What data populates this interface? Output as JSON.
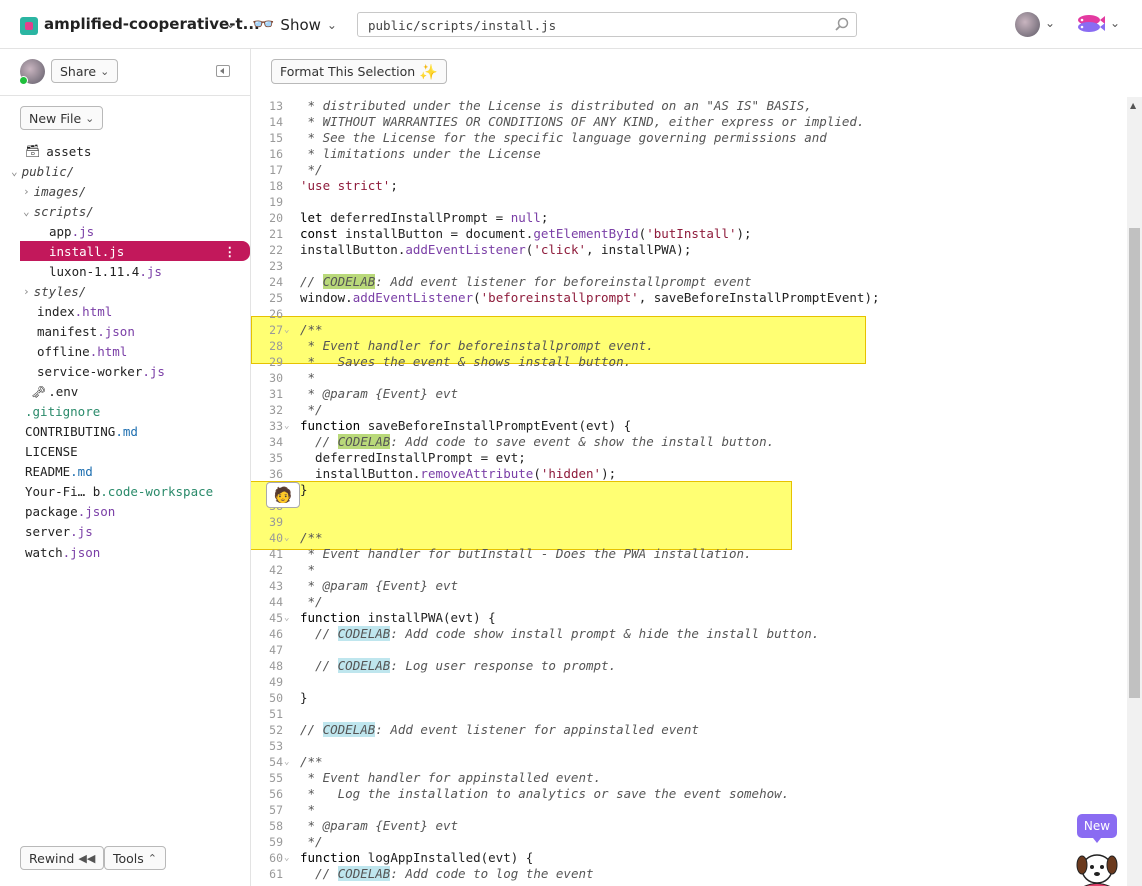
{
  "topbar": {
    "project_name": "amplified-cooperative-t...",
    "show_label": "Show",
    "path": "public/scripts/install.js"
  },
  "sidebar": {
    "share_label": "Share",
    "new_file_label": "New File",
    "rewind_label": "Rewind",
    "tools_label": "Tools",
    "tree": [
      {
        "label": "assets",
        "ext": "",
        "type": "assets",
        "depth": 0
      },
      {
        "label": "public/",
        "ext": "",
        "type": "dir-open",
        "depth": 0
      },
      {
        "label": "images/",
        "ext": "",
        "type": "dir-closed",
        "depth": 1
      },
      {
        "label": "scripts/",
        "ext": "",
        "type": "dir-open",
        "depth": 1
      },
      {
        "label": "app",
        "ext": ".js",
        "type": "file",
        "depth": 2
      },
      {
        "label": "install",
        "ext": ".js",
        "type": "file-selected",
        "depth": 2
      },
      {
        "label": "luxon-1.11.4",
        "ext": ".js",
        "type": "file",
        "depth": 2
      },
      {
        "label": "styles/",
        "ext": "",
        "type": "dir-closed",
        "depth": 1
      },
      {
        "label": "index",
        "ext": ".html",
        "type": "file",
        "depth": 1
      },
      {
        "label": "manifest",
        "ext": ".json",
        "type": "file",
        "depth": 1
      },
      {
        "label": "offline",
        "ext": ".html",
        "type": "file",
        "depth": 1
      },
      {
        "label": "service-worker",
        "ext": ".js",
        "type": "file",
        "depth": 1
      },
      {
        "label": ".env",
        "ext": "",
        "type": "env",
        "depth": 0
      },
      {
        "label": ".gitignore",
        "ext": "",
        "type": "file-green",
        "depth": 0
      },
      {
        "label": "CONTRIBUTING",
        "ext": ".md",
        "type": "file-md",
        "depth": 0
      },
      {
        "label": "LICENSE",
        "ext": "",
        "type": "file",
        "depth": 0
      },
      {
        "label": "README",
        "ext": ".md",
        "type": "file-md",
        "depth": 0
      },
      {
        "label": "Your-Fi… b",
        "ext": ".code-workspace",
        "type": "file-green",
        "depth": 0
      },
      {
        "label": "package",
        "ext": ".json",
        "type": "file",
        "depth": 0
      },
      {
        "label": "server",
        "ext": ".js",
        "type": "file",
        "depth": 0
      },
      {
        "label": "watch",
        "ext": ".json",
        "type": "file",
        "depth": 0
      }
    ]
  },
  "editor": {
    "format_label": "Format This Selection",
    "new_badge": "New",
    "lines": [
      {
        "n": "13",
        "fold": "",
        "segs": [
          [
            "cm",
            " * distributed under the License is distributed on an \"AS IS\" BASIS,"
          ]
        ]
      },
      {
        "n": "14",
        "fold": "",
        "segs": [
          [
            "cm",
            " * WITHOUT WARRANTIES OR CONDITIONS OF ANY KIND, either express or implied."
          ]
        ]
      },
      {
        "n": "15",
        "fold": "",
        "segs": [
          [
            "cm",
            " * See the License for the specific language governing permissions and"
          ]
        ]
      },
      {
        "n": "16",
        "fold": "",
        "segs": [
          [
            "cm",
            " * limitations under the License"
          ]
        ]
      },
      {
        "n": "17",
        "fold": "",
        "segs": [
          [
            "cm",
            " */"
          ]
        ]
      },
      {
        "n": "18",
        "fold": "",
        "segs": [
          [
            "str",
            "'use strict'"
          ],
          [
            "",
            ";"
          ]
        ]
      },
      {
        "n": "19",
        "fold": "",
        "segs": []
      },
      {
        "n": "20",
        "fold": "",
        "segs": [
          [
            "kw",
            "let"
          ],
          [
            "",
            " deferredInstallPrompt = "
          ],
          [
            "lit",
            "null"
          ],
          [
            "",
            ";"
          ]
        ]
      },
      {
        "n": "21",
        "fold": "",
        "segs": [
          [
            "kw",
            "const"
          ],
          [
            "",
            " installButton = document."
          ],
          [
            "fn",
            "getElementById"
          ],
          [
            "",
            "("
          ],
          [
            "str",
            "'butInstall'"
          ],
          [
            "",
            ");"
          ]
        ]
      },
      {
        "n": "22",
        "fold": "",
        "segs": [
          [
            "",
            "installButton."
          ],
          [
            "fn",
            "addEventListener"
          ],
          [
            "",
            "("
          ],
          [
            "str",
            "'click'"
          ],
          [
            "",
            ", installPWA);"
          ]
        ]
      },
      {
        "n": "23",
        "fold": "",
        "segs": []
      },
      {
        "n": "24",
        "fold": "",
        "segs": [
          [
            "cm",
            "// "
          ],
          [
            "cm tag-green",
            "CODELAB"
          ],
          [
            "cm",
            ": Add event listener for beforeinstallprompt event"
          ]
        ]
      },
      {
        "n": "25",
        "fold": "",
        "segs": [
          [
            "",
            "window."
          ],
          [
            "fn",
            "addEventListener"
          ],
          [
            "",
            "("
          ],
          [
            "str",
            "'beforeinstallprompt'"
          ],
          [
            "",
            ", saveBeforeInstallPromptEvent);"
          ]
        ]
      },
      {
        "n": "26",
        "fold": "",
        "segs": []
      },
      {
        "n": "27",
        "fold": "v",
        "segs": [
          [
            "cm",
            "/**"
          ]
        ]
      },
      {
        "n": "28",
        "fold": "",
        "segs": [
          [
            "cm",
            " * Event handler for beforeinstallprompt event."
          ]
        ]
      },
      {
        "n": "29",
        "fold": "",
        "segs": [
          [
            "cm",
            " *   Saves the event & shows install button."
          ]
        ]
      },
      {
        "n": "30",
        "fold": "",
        "segs": [
          [
            "cm",
            " *"
          ]
        ]
      },
      {
        "n": "31",
        "fold": "",
        "segs": [
          [
            "cm",
            " * @param {Event} evt"
          ]
        ]
      },
      {
        "n": "32",
        "fold": "",
        "segs": [
          [
            "cm",
            " */"
          ]
        ]
      },
      {
        "n": "33",
        "fold": "v",
        "segs": [
          [
            "kw",
            "function"
          ],
          [
            "",
            " saveBeforeInstallPromptEvent(evt) {"
          ]
        ]
      },
      {
        "n": "34",
        "fold": "",
        "segs": [
          [
            "",
            "  "
          ],
          [
            "cm",
            "// "
          ],
          [
            "cm tag-green",
            "CODELAB"
          ],
          [
            "cm",
            ": Add code to save event & show the install button."
          ]
        ]
      },
      {
        "n": "35",
        "fold": "",
        "segs": [
          [
            "",
            "  deferredInstallPrompt = evt;"
          ]
        ]
      },
      {
        "n": "36",
        "fold": "",
        "segs": [
          [
            "",
            "  installButton."
          ],
          [
            "fn",
            "removeAttribute"
          ],
          [
            "",
            "("
          ],
          [
            "str",
            "'hidden'"
          ],
          [
            "",
            ");"
          ]
        ]
      },
      {
        "n": "37",
        "fold": "",
        "segs": [
          [
            "",
            "}"
          ]
        ]
      },
      {
        "n": "38",
        "fold": "",
        "segs": []
      },
      {
        "n": "39",
        "fold": "",
        "segs": []
      },
      {
        "n": "40",
        "fold": "v",
        "segs": [
          [
            "cm",
            "/**"
          ]
        ]
      },
      {
        "n": "41",
        "fold": "",
        "segs": [
          [
            "cm",
            " * Event handler for butInstall - Does the PWA installation."
          ]
        ]
      },
      {
        "n": "42",
        "fold": "",
        "segs": [
          [
            "cm",
            " *"
          ]
        ]
      },
      {
        "n": "43",
        "fold": "",
        "segs": [
          [
            "cm",
            " * @param {Event} evt"
          ]
        ]
      },
      {
        "n": "44",
        "fold": "",
        "segs": [
          [
            "cm",
            " */"
          ]
        ]
      },
      {
        "n": "45",
        "fold": "v",
        "segs": [
          [
            "kw",
            "function"
          ],
          [
            "",
            " installPWA(evt) {"
          ]
        ]
      },
      {
        "n": "46",
        "fold": "",
        "segs": [
          [
            "",
            "  "
          ],
          [
            "cm",
            "// "
          ],
          [
            "cm tag",
            "CODELAB"
          ],
          [
            "cm",
            ": Add code show install prompt & hide the install button."
          ]
        ]
      },
      {
        "n": "47",
        "fold": "",
        "segs": []
      },
      {
        "n": "48",
        "fold": "",
        "segs": [
          [
            "",
            "  "
          ],
          [
            "cm",
            "// "
          ],
          [
            "cm tag",
            "CODELAB"
          ],
          [
            "cm",
            ": Log user response to prompt."
          ]
        ]
      },
      {
        "n": "49",
        "fold": "",
        "segs": []
      },
      {
        "n": "50",
        "fold": "",
        "segs": [
          [
            "",
            "}"
          ]
        ]
      },
      {
        "n": "51",
        "fold": "",
        "segs": []
      },
      {
        "n": "52",
        "fold": "",
        "segs": [
          [
            "cm",
            "// "
          ],
          [
            "cm tag",
            "CODELAB"
          ],
          [
            "cm",
            ": Add event listener for appinstalled event"
          ]
        ]
      },
      {
        "n": "53",
        "fold": "",
        "segs": []
      },
      {
        "n": "54",
        "fold": "v",
        "segs": [
          [
            "cm",
            "/**"
          ]
        ]
      },
      {
        "n": "55",
        "fold": "",
        "segs": [
          [
            "cm",
            " * Event handler for appinstalled event."
          ]
        ]
      },
      {
        "n": "56",
        "fold": "",
        "segs": [
          [
            "cm",
            " *   Log the installation to analytics or save the event somehow."
          ]
        ]
      },
      {
        "n": "57",
        "fold": "",
        "segs": [
          [
            "cm",
            " *"
          ]
        ]
      },
      {
        "n": "58",
        "fold": "",
        "segs": [
          [
            "cm",
            " * @param {Event} evt"
          ]
        ]
      },
      {
        "n": "59",
        "fold": "",
        "segs": [
          [
            "cm",
            " */"
          ]
        ]
      },
      {
        "n": "60",
        "fold": "v",
        "segs": [
          [
            "kw",
            "function"
          ],
          [
            "",
            " logAppInstalled(evt) {"
          ]
        ]
      },
      {
        "n": "61",
        "fold": "",
        "segs": [
          [
            "",
            "  "
          ],
          [
            "cm",
            "// "
          ],
          [
            "cm tag",
            "CODELAB"
          ],
          [
            "cm",
            ": Add code to log the event"
          ]
        ]
      }
    ]
  }
}
